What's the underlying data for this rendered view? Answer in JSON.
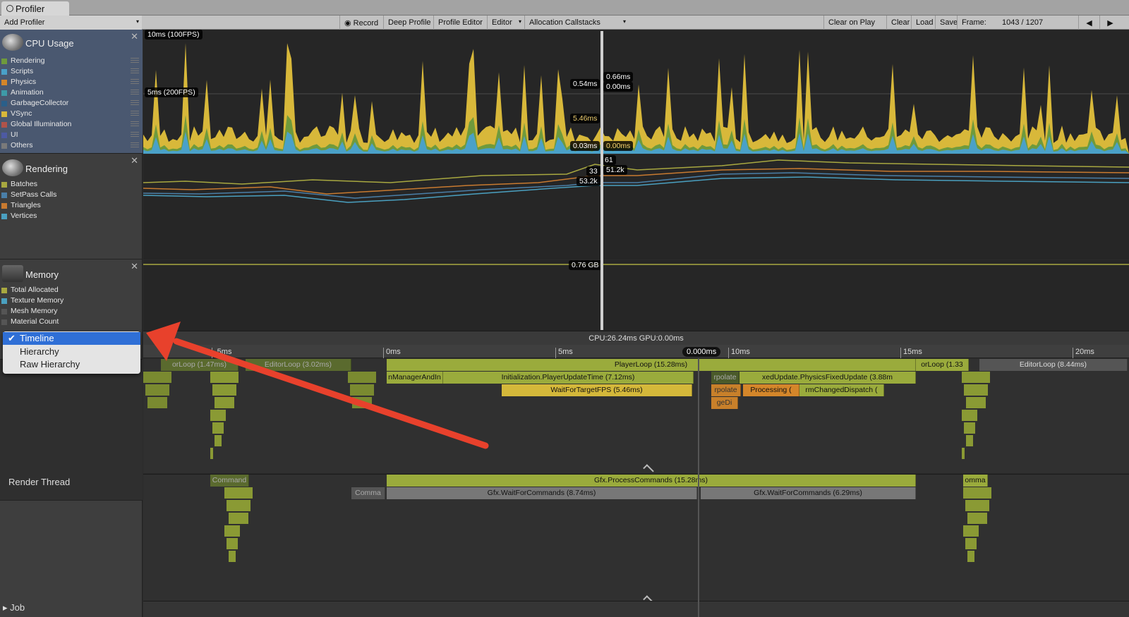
{
  "window": {
    "tab_title": "Profiler"
  },
  "toolbar": {
    "add_profiler": "Add Profiler",
    "record": "Record",
    "deep_profile": "Deep Profile",
    "profile_editor": "Profile Editor",
    "editor": "Editor",
    "allocation_callstacks": "Allocation Callstacks",
    "clear_on_play": "Clear on Play",
    "clear": "Clear",
    "load": "Load",
    "save": "Save",
    "frame_label": "Frame:",
    "frame_value": "1043 / 1207"
  },
  "modules": {
    "cpu": {
      "title": "CPU Usage",
      "items": [
        {
          "label": "Rendering",
          "color": "#6f9a3c"
        },
        {
          "label": "Scripts",
          "color": "#4aa1c8"
        },
        {
          "label": "Physics",
          "color": "#d4862a"
        },
        {
          "label": "Animation",
          "color": "#3e9aa8"
        },
        {
          "label": "GarbageCollector",
          "color": "#2a5f8a"
        },
        {
          "label": "VSync",
          "color": "#d8b83a"
        },
        {
          "label": "Global Illumination",
          "color": "#b0534a"
        },
        {
          "label": "UI",
          "color": "#4d5aa3"
        },
        {
          "label": "Others",
          "color": "#7a7a7a"
        }
      ]
    },
    "rendering": {
      "title": "Rendering",
      "items": [
        {
          "label": "Batches",
          "color": "#a8a840"
        },
        {
          "label": "SetPass Calls",
          "color": "#4a7fa8"
        },
        {
          "label": "Triangles",
          "color": "#c87a30"
        },
        {
          "label": "Vertices",
          "color": "#4aa0c0"
        }
      ]
    },
    "memory": {
      "title": "Memory",
      "items": [
        {
          "label": "Total Allocated",
          "color": "#a8a840"
        },
        {
          "label": "Texture Memory",
          "color": "#4aa0c0"
        },
        {
          "label": "Mesh Memory",
          "color": "#555"
        },
        {
          "label": "Material Count",
          "color": "#555"
        }
      ]
    }
  },
  "view_menu": {
    "items": [
      {
        "label": "Timeline",
        "selected": true
      },
      {
        "label": "Hierarchy",
        "selected": false
      },
      {
        "label": "Raw Hierarchy",
        "selected": false
      }
    ]
  },
  "cpu_graph": {
    "label_top": "10ms (100FPS)",
    "label_mid": "5ms (200FPS)",
    "values": [
      "0.54ms",
      "0.66ms",
      "0.00ms",
      "5.46ms",
      "0.03ms",
      "0.00ms"
    ]
  },
  "rendering_graph": {
    "values": [
      "61",
      "33",
      "51.2k",
      "53.2k"
    ]
  },
  "memory_graph": {
    "values": [
      "0.76 GB"
    ]
  },
  "status": {
    "cpu_gpu": "CPU:26.24ms   GPU:0.00ms"
  },
  "ruler": {
    "ticks": [
      "-5ms",
      "0ms",
      "5ms",
      "10ms",
      "15ms",
      "20ms"
    ],
    "cursor_time": "0.000ms"
  },
  "main_thread": {
    "bars": [
      {
        "text": "orLoop (1.47ms)",
        "c": "#5a6a2e"
      },
      {
        "text": "EditorLoop (3.02ms)",
        "c": "#5a6a2e"
      },
      {
        "text": "PlayerLoop (15.28ms)",
        "c": "#9aab3c"
      },
      {
        "text": "orLoop (1.33",
        "c": "#9aab3c"
      },
      {
        "text": "EditorLoop (8.44ms)",
        "c": "#888"
      },
      {
        "text": "nManagerAndIn",
        "c": "#9aab3c"
      },
      {
        "text": "Initialization.PlayerUpdateTime (7.12ms)",
        "c": "#9aab3c"
      },
      {
        "text": "rpolate",
        "c": "#4a5a2a"
      },
      {
        "text": "xedUpdate.PhysicsFixedUpdate (3.88m",
        "c": "#9aab3c"
      },
      {
        "text": "WaitForTargetFPS (5.46ms)",
        "c": "#d4b83a"
      },
      {
        "text": "rpolate",
        "c": "#c8802a"
      },
      {
        "text": "Processing (",
        "c": "#d4862a"
      },
      {
        "text": "rmChangedDispatch (",
        "c": "#9aab3c"
      },
      {
        "text": "geDi",
        "c": "#c8802a"
      }
    ]
  },
  "render_thread": {
    "label": "Render Thread",
    "bars": [
      {
        "text": "Gfx.ProcessCommands (15.28ms)",
        "c": "#9aab3c"
      },
      {
        "text": "Gfx.WaitForCommands (8.74ms)",
        "c": "#888"
      },
      {
        "text": "Gfx.WaitForCommands (6.29ms)",
        "c": "#888"
      },
      {
        "text": "Command",
        "c": "#5a6a2e"
      },
      {
        "text": "Comma",
        "c": "#5a6a2e"
      },
      {
        "text": "omma",
        "c": "#9aab3c"
      }
    ]
  },
  "job": {
    "label": "Job"
  }
}
